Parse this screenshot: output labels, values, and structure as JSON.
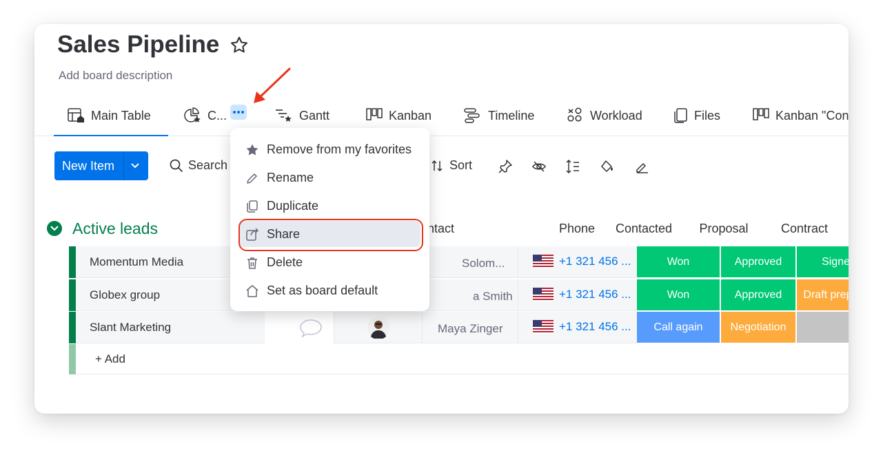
{
  "board": {
    "title": "Sales Pipeline",
    "description": "Add board description"
  },
  "tabs": [
    {
      "label": "Main Table",
      "icon": "table-home-icon"
    },
    {
      "label": "C...",
      "icon": "chart-star-icon"
    },
    {
      "label": "Gantt",
      "icon": "gantt-icon"
    },
    {
      "label": "Kanban",
      "icon": "kanban-icon"
    },
    {
      "label": "Timeline",
      "icon": "timeline-icon"
    },
    {
      "label": "Workload",
      "icon": "workload-icon"
    },
    {
      "label": "Files",
      "icon": "files-icon"
    },
    {
      "label": "Kanban \"Con",
      "icon": "kanban-icon"
    }
  ],
  "toolbar": {
    "new_item": "New Item",
    "search": "Search",
    "sort": "Sort"
  },
  "group": {
    "title": "Active leads",
    "color": "#037f4c",
    "columns": [
      "ntact",
      "Phone",
      "Contacted",
      "Proposal",
      "Contract"
    ],
    "add_label": "+ Add",
    "rows": [
      {
        "name": "Momentum Media",
        "contact": "Solom...",
        "phone": "+1 321 456 ...",
        "contacted": {
          "label": "Won",
          "color": "#00c875"
        },
        "proposal": {
          "label": "Approved",
          "color": "#00c875"
        },
        "contract": {
          "label": "Signed",
          "color": "#00c875"
        }
      },
      {
        "name": "Globex group",
        "contact": "a Smith",
        "phone": "+1 321 456 ...",
        "contacted": {
          "label": "Won",
          "color": "#00c875"
        },
        "proposal": {
          "label": "Approved",
          "color": "#00c875"
        },
        "contract": {
          "label": "Draft prepared",
          "color": "#fdab3d"
        }
      },
      {
        "name": "Slant Marketing",
        "contact": "Maya Zinger",
        "phone": "+1 321 456 ...",
        "contacted": {
          "label": "Call again",
          "color": "#579bfc"
        },
        "proposal": {
          "label": "Negotiation",
          "color": "#fdab3d"
        },
        "contract": {
          "label": "",
          "color": "#c4c4c4"
        }
      }
    ]
  },
  "context_menu": {
    "items": [
      {
        "label": "Remove from my favorites",
        "icon": "star-filled-icon"
      },
      {
        "label": "Rename",
        "icon": "pencil-icon"
      },
      {
        "label": "Duplicate",
        "icon": "duplicate-icon"
      },
      {
        "label": "Share",
        "icon": "share-icon",
        "highlighted": true
      },
      {
        "label": "Delete",
        "icon": "trash-icon"
      },
      {
        "label": "Set as board default",
        "icon": "home-icon"
      }
    ]
  },
  "colors": {
    "accent": "#0073ea",
    "group_green": "#037f4c",
    "annotation_red": "#e8341c"
  }
}
